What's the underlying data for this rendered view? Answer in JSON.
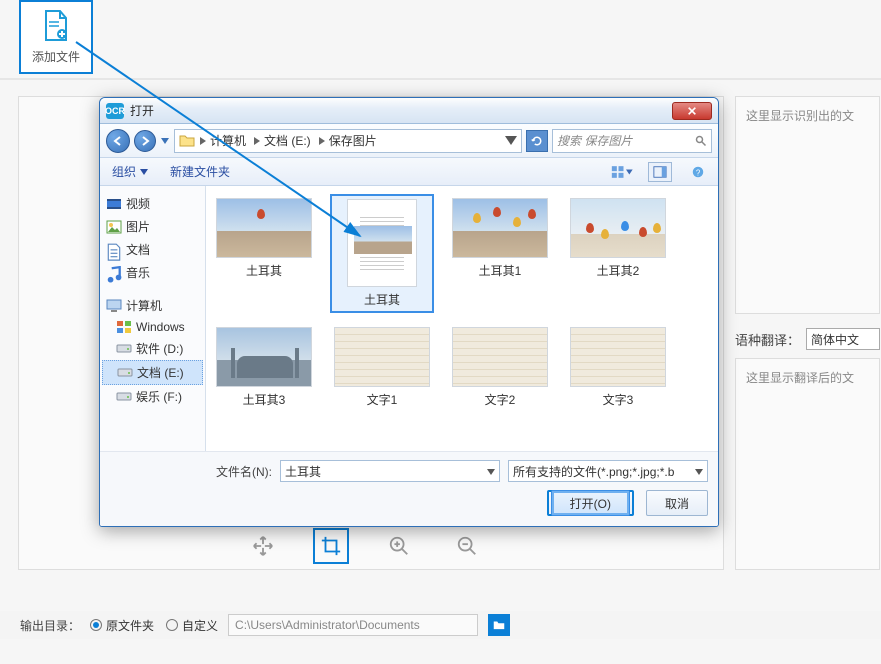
{
  "app": {
    "add_file_label": "添加文件"
  },
  "right_pane": {
    "ocr_placeholder": "这里显示识别出的文",
    "translate_placeholder": "这里显示翻译后的文",
    "lang_label": "语种翻译：",
    "lang_value": "简体中文"
  },
  "output": {
    "label": "输出目录：",
    "opt_original": "原文件夹",
    "opt_custom": "自定义",
    "path": "C:\\Users\\Administrator\\Documents"
  },
  "dialog": {
    "ocr_badge": "OCR",
    "title": "打开",
    "breadcrumb": {
      "seg1": "计算机",
      "seg2": "文档 (E:)",
      "seg3": "保存图片"
    },
    "search_placeholder": "搜索 保存图片",
    "toolbar": {
      "organize": "组织",
      "new_folder": "新建文件夹"
    },
    "tree": {
      "g1": [
        {
          "label": "视频",
          "icon": "video"
        },
        {
          "label": "图片",
          "icon": "picture"
        },
        {
          "label": "文档",
          "icon": "doc"
        },
        {
          "label": "音乐",
          "icon": "music"
        }
      ],
      "g2_header": "计算机",
      "g2": [
        {
          "label": "Windows",
          "icon": "win"
        },
        {
          "label": "软件 (D:)",
          "icon": "drive"
        },
        {
          "label": "文档 (E:)",
          "icon": "drive",
          "selected": true
        },
        {
          "label": "娱乐 (F:)",
          "icon": "drive"
        }
      ]
    },
    "files": [
      {
        "label": "土耳其",
        "kind": "photo-balloon"
      },
      {
        "label": "土耳其",
        "kind": "doc-with-image",
        "selected": true
      },
      {
        "label": "土耳其1",
        "kind": "photo-balloons"
      },
      {
        "label": "土耳其2",
        "kind": "photo-plain-balloons"
      },
      {
        "label": "土耳其3",
        "kind": "photo-mosque"
      },
      {
        "label": "文字1",
        "kind": "textpage"
      },
      {
        "label": "文字2",
        "kind": "textpage"
      },
      {
        "label": "文字3",
        "kind": "textpage"
      }
    ],
    "filename_label": "文件名(N):",
    "filename_value": "土耳其",
    "filetype_value": "所有支持的文件(*.png;*.jpg;*.b",
    "open_btn": "打开(O)",
    "cancel_btn": "取消"
  }
}
